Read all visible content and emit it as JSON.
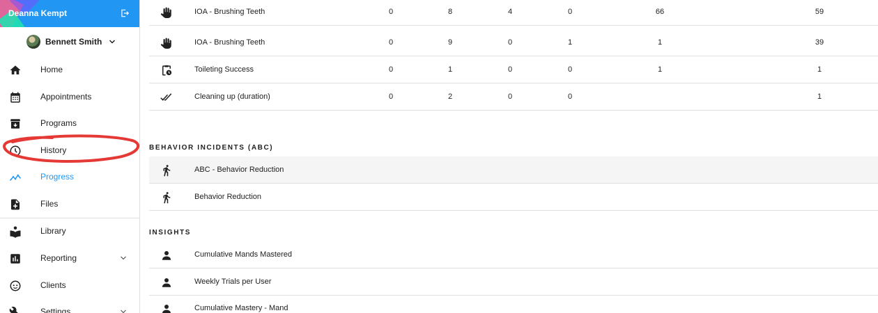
{
  "sidebar": {
    "user_name": "Deanna Kempt",
    "profile_name": "Bennett Smith",
    "items": [
      {
        "label": "Home",
        "icon": "home-icon"
      },
      {
        "label": "Appointments",
        "icon": "calendar-icon"
      },
      {
        "label": "Programs",
        "icon": "archive-icon"
      },
      {
        "label": "History",
        "icon": "clock-icon"
      },
      {
        "label": "Progress",
        "icon": "trending-icon",
        "active": true
      },
      {
        "label": "Files",
        "icon": "file-add-icon"
      },
      {
        "label": "Library",
        "icon": "book-reader-icon"
      },
      {
        "label": "Reporting",
        "icon": "bar-chart-icon",
        "expandable": true
      },
      {
        "label": "Clients",
        "icon": "face-icon"
      },
      {
        "label": "Settings",
        "icon": "wrench-icon",
        "expandable": true
      }
    ]
  },
  "programs_table": {
    "rows": [
      {
        "icon": "hand-icon",
        "name": "IOA - Brushing Teeth",
        "values": [
          "0",
          "8",
          "4",
          "0",
          "66",
          "59"
        ]
      },
      {
        "icon": "hand-icon",
        "name": "IOA - Brushing Teeth",
        "values": [
          "0",
          "9",
          "0",
          "1",
          "1",
          "39"
        ]
      },
      {
        "icon": "clipboard-clock-icon",
        "name": "Toileting Success",
        "values": [
          "0",
          "1",
          "0",
          "0",
          "1",
          "1"
        ]
      },
      {
        "icon": "double-check-icon",
        "name": "Cleaning up (duration)",
        "values": [
          "0",
          "2",
          "0",
          "0",
          "",
          "1"
        ]
      }
    ]
  },
  "behavior_section": {
    "title": "BEHAVIOR INCIDENTS (ABC)",
    "rows": [
      {
        "icon": "running-person-icon",
        "name": "ABC - Behavior Reduction"
      },
      {
        "icon": "running-person-icon",
        "name": "Behavior Reduction"
      }
    ]
  },
  "insights_section": {
    "title": "INSIGHTS",
    "rows": [
      {
        "icon": "person-icon",
        "name": "Cumulative Mands Mastered"
      },
      {
        "icon": "person-icon",
        "name": "Weekly Trials per User"
      },
      {
        "icon": "person-icon",
        "name": "Cumulative Mastery - Mand"
      }
    ]
  },
  "colors": {
    "brand": "#2196f3",
    "annotation": "#e53935",
    "divider": "#e0e0e0"
  }
}
